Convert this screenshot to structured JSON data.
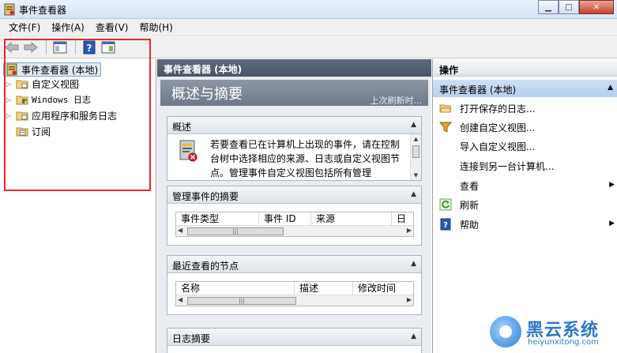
{
  "window": {
    "title": "事件查看器"
  },
  "menu": [
    "文件(F)",
    "操作(A)",
    "查看(V)",
    "帮助(H)"
  ],
  "tree": {
    "root": "事件查看器 (本地)",
    "nodes": [
      "自定义视图",
      "Windows 日志",
      "应用程序和服务日志",
      "订阅"
    ]
  },
  "center": {
    "header": "事件查看器 (本地)",
    "banner_title": "概述与摘要",
    "banner_sub": "上次刷新时...",
    "overview": {
      "title": "概述",
      "text": "若要查看已在计算机上出现的事件，请在控制台树中选择相应的来源、日志或自定义视图节点。管理事件自定义视图包括所有管理"
    },
    "summary": {
      "title": "管理事件的摘要",
      "columns": [
        "事件类型",
        "事件 ID",
        "来源",
        "日"
      ]
    },
    "recent": {
      "title": "最近查看的节点",
      "columns": [
        "名称",
        "描述",
        "修改时间"
      ]
    },
    "logs": {
      "title": "日志摘要"
    }
  },
  "actions": {
    "header": "操作",
    "group": "事件查看器 (本地)",
    "items": [
      "打开保存的日志...",
      "创建自定义视图...",
      "导入自定义视图...",
      "连接到另一台计算机...",
      "查看",
      "刷新",
      "帮助"
    ]
  },
  "watermark": {
    "brand": "黑云系统",
    "url": "heiyunxitong.com"
  },
  "colors": {
    "highlight_box": "#e8262b",
    "selection": "#dfeaf7",
    "header_dark": "#4a5666"
  }
}
